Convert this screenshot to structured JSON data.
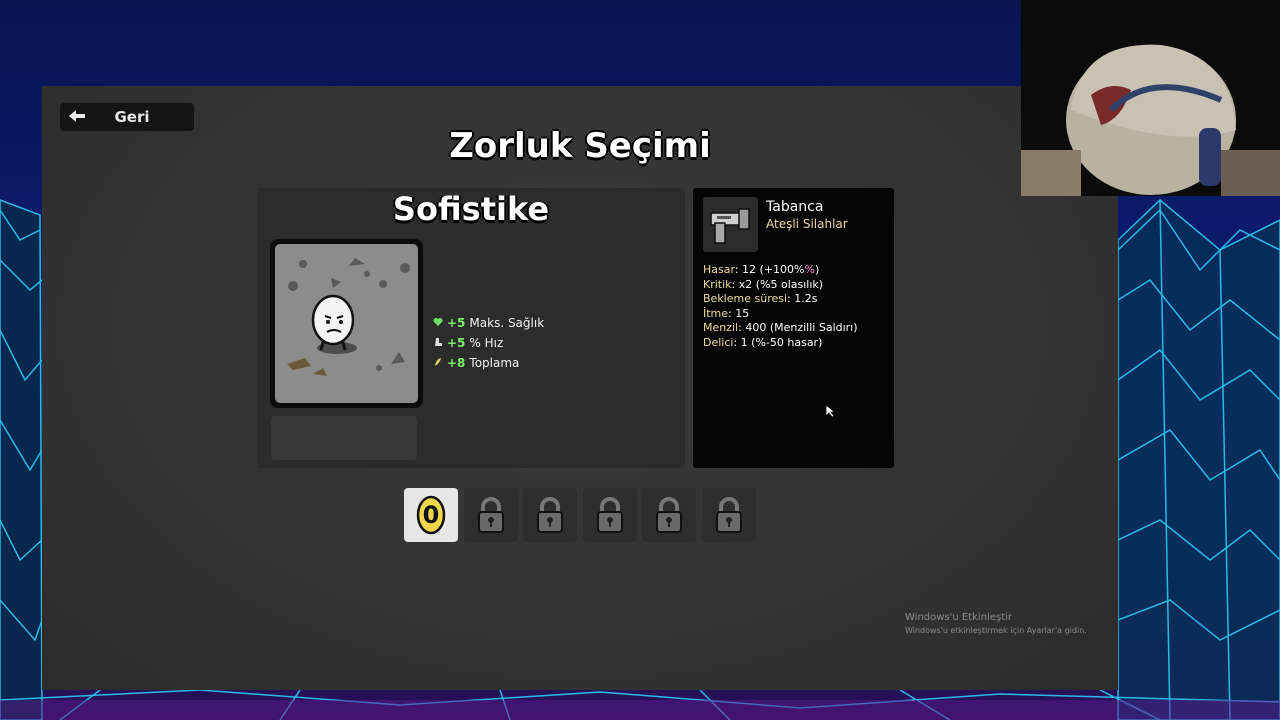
{
  "header": {
    "back_label": "Geri",
    "title": "Zorluk Seçimi"
  },
  "difficulty": {
    "name": "Sofistike",
    "stats": [
      {
        "icon": "heart-icon",
        "value": "+5",
        "label": "Maks. Sağlık"
      },
      {
        "icon": "boot-icon",
        "value": "+5",
        "label": "% Hız"
      },
      {
        "icon": "pickup-icon",
        "value": "+8",
        "label": "Toplama"
      }
    ]
  },
  "weapon": {
    "name": "Tabanca",
    "class": "Ateşli Silahlar",
    "stats": {
      "damage_key": "Hasar",
      "damage_value": "12 (+100%",
      "damage_pct_symbol": "%",
      "damage_close": ")",
      "crit_key": "Kritik",
      "crit_value": "x2 (%5 olasılık)",
      "cooldown_key": "Bekleme süresi",
      "cooldown_value": "1.2s",
      "knockback_key": "İtme",
      "knockback_value": "15",
      "range_key": "Menzil",
      "range_value": "400 (Menzilli Saldırı)",
      "pierce_key": "Delici",
      "pierce_value": "1 (%-50 hasar)"
    }
  },
  "slots": [
    {
      "state": "selected",
      "icon": "difficulty-zero-icon",
      "glyph": "0"
    },
    {
      "state": "locked",
      "icon": "lock-icon"
    },
    {
      "state": "locked",
      "icon": "lock-icon"
    },
    {
      "state": "locked",
      "icon": "lock-icon"
    },
    {
      "state": "locked",
      "icon": "lock-icon"
    },
    {
      "state": "locked",
      "icon": "lock-icon"
    }
  ],
  "watermark": {
    "title": "Windows'u Etkinleştir",
    "subtitle": "Windows'u etkinleştirmek için Ayarlar'a gidin."
  },
  "colors": {
    "positive": "#7cf06b",
    "weapon_key": "#eadba0",
    "panel": "#333333"
  }
}
